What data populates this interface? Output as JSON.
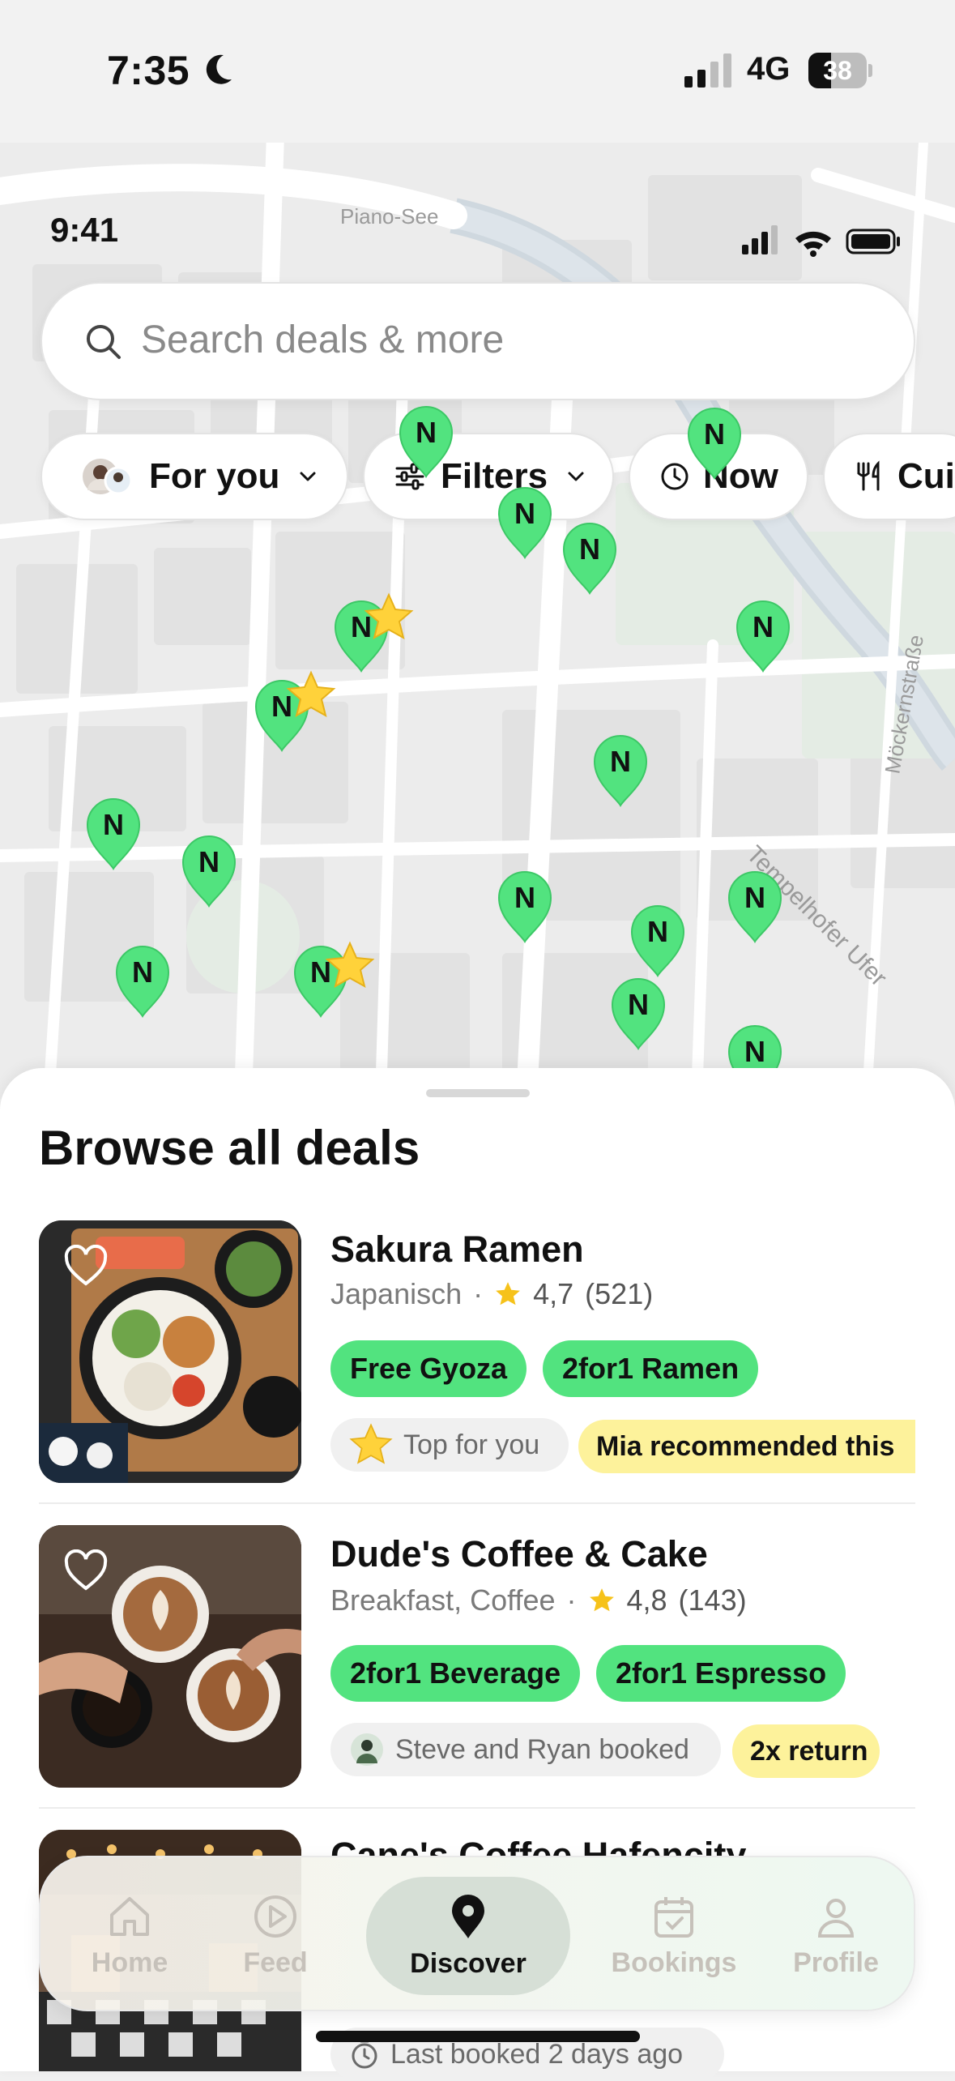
{
  "status_bar": {
    "time": "7:35",
    "network": "4G",
    "battery": "38"
  },
  "inner_status": {
    "time": "9:41"
  },
  "map": {
    "street_labels": [
      "Tempelhofer Ufer",
      "Piano-See",
      "Möckernstraße"
    ],
    "pin_letter": "N",
    "accent_color": "#52e37f"
  },
  "search": {
    "placeholder": "Search deals & more"
  },
  "filters": [
    {
      "label": "For you",
      "icon": "avatar-icon"
    },
    {
      "label": "Filters",
      "icon": "sliders-icon"
    },
    {
      "label": "Now",
      "icon": "clock-icon"
    },
    {
      "label": "Cui",
      "icon": "fork-knife-icon"
    }
  ],
  "sheet": {
    "title": "Browse all deals",
    "restaurants": [
      {
        "name": "Sakura Ramen",
        "cuisine": "Japanisch",
        "rating": "4,7",
        "reviews": "(521)",
        "deals": [
          "Free Gyoza",
          "2for1 Ramen"
        ],
        "tags": [
          "Top for you",
          "Mia recommended this"
        ]
      },
      {
        "name": "Dude's Coffee & Cake",
        "cuisine": "Breakfast, Coffee",
        "rating": "4,8",
        "reviews": "(143)",
        "deals": [
          "2for1 Beverage",
          "2for1 Espresso"
        ],
        "tags": [
          "Steve and Ryan booked",
          "2x return"
        ]
      },
      {
        "name": "Cane's Coffee Hafencity",
        "tags": [
          "Last booked 2 days ago"
        ]
      }
    ]
  },
  "tabbar": {
    "tabs": [
      {
        "label": "Home",
        "icon": "home-icon"
      },
      {
        "label": "Feed",
        "icon": "play-icon"
      },
      {
        "label": "Discover",
        "icon": "map-pin-icon",
        "active": true
      },
      {
        "label": "Bookings",
        "icon": "calendar-icon"
      },
      {
        "label": "Profile",
        "icon": "person-icon"
      }
    ]
  }
}
